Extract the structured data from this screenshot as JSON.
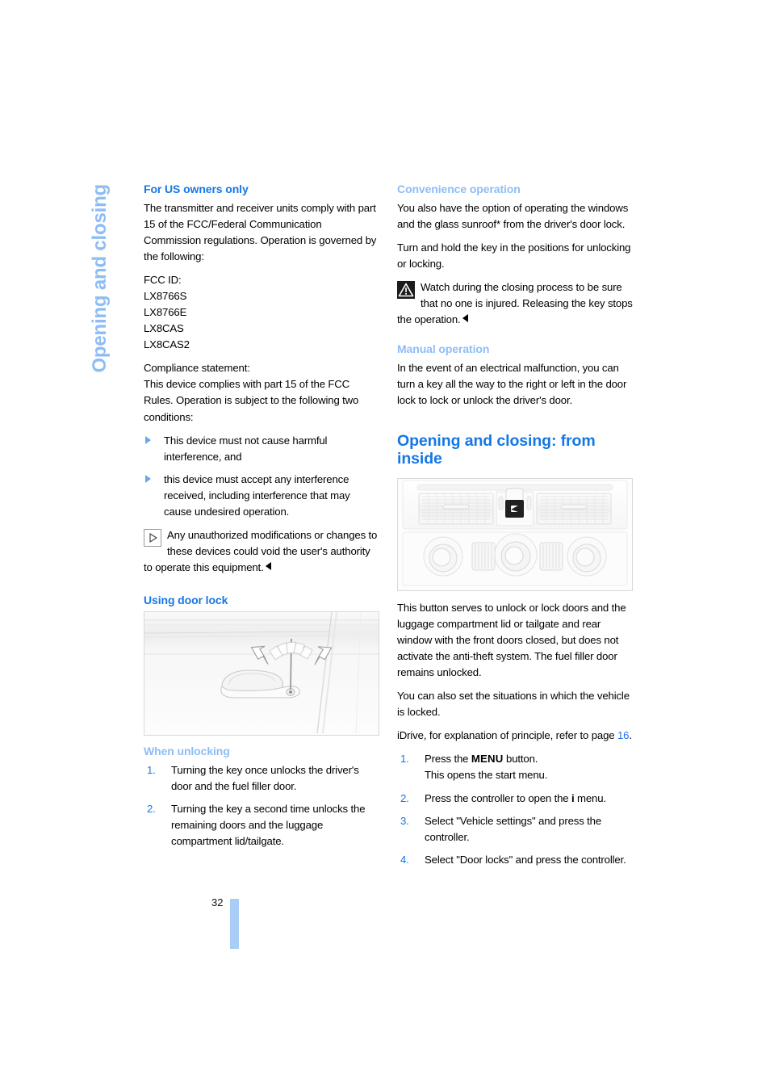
{
  "chapter": {
    "title": "Opening and closing",
    "page_number": "32"
  },
  "left_column": {
    "heading_us_owners": "For US owners only",
    "para_transmitter": "The transmitter and receiver units comply with part 15 of the FCC/Federal Communication Commission regulations. Operation is governed by the following:",
    "fcc_id_label": "FCC ID:",
    "fcc_ids": [
      "LX8766S",
      "LX8766E",
      "LX8CAS",
      "LX8CAS2"
    ],
    "compliance_label": "Compliance statement:",
    "compliance_text": "This device complies with part 15 of the FCC Rules. Operation is subject to the following two conditions:",
    "conditions": [
      "This device must not cause harmful interference, and",
      "this device must accept any interference received, including interference that may cause undesired operation."
    ],
    "note_unauthorized": "Any unauthorized modifications or changes to these devices could void the user's authority to operate this equipment.",
    "heading_using_door_lock": "Using door lock",
    "figure_doorlock_caption": "",
    "figure_doorlock_credit": "",
    "heading_when_unlocking": "When unlocking",
    "unlocking_steps": [
      {
        "num": "1.",
        "text": "Turning the key once unlocks the driver's door and the fuel filler door."
      },
      {
        "num": "2.",
        "text": "Turning the key a second time unlocks the remaining doors and the luggage compartment lid/tailgate."
      }
    ]
  },
  "right_column": {
    "heading_convenience": "Convenience operation",
    "para_convenience_1_a": "You also have the option of operating the windows and the glass sunroof",
    "para_convenience_1_ast": "*",
    "para_convenience_1_b": " from the driver's door lock.",
    "para_convenience_2": "Turn and hold the key in the positions for unlocking or locking.",
    "warning_closing": "Watch during the closing process to be sure that no one is injured. Releasing the key stops the operation.",
    "heading_manual": "Manual operation",
    "para_manual": "In the event of an electrical malfunction, you can turn a key all the way to the right or left in the door lock to lock or unlock the driver's door.",
    "heading_from_inside": "Opening and closing: from inside",
    "figure_console_credit": "",
    "para_button": "This button serves to unlock or lock doors and the luggage compartment lid or tailgate and rear window with the front doors closed, but does not activate the anti-theft system. The fuel filler door remains unlocked.",
    "para_situations": "You can also set the situations in which the vehicle is locked.",
    "idrive_prefix": "iDrive, for explanation of principle, refer to page ",
    "idrive_page": "16",
    "idrive_suffix": ".",
    "idrive_steps": [
      {
        "num": "1.",
        "pre": "Press the ",
        "key": "MENU",
        "post": " button.",
        "sub": "This opens the start menu."
      },
      {
        "num": "2.",
        "pre": "Press the controller to open the ",
        "key": "i",
        "post": " menu.",
        "sub": ""
      },
      {
        "num": "3.",
        "pre": "Select \"Vehicle settings\" and press the controller.",
        "key": "",
        "post": "",
        "sub": ""
      },
      {
        "num": "4.",
        "pre": "Select \"Door locks\" and press the controller.",
        "key": "",
        "post": "",
        "sub": ""
      }
    ]
  },
  "colors": {
    "heading_strong": "#1477e6",
    "heading_light": "#8ebdf5",
    "folio_bar": "#a8cdf6",
    "link": "#1d6ff0"
  }
}
